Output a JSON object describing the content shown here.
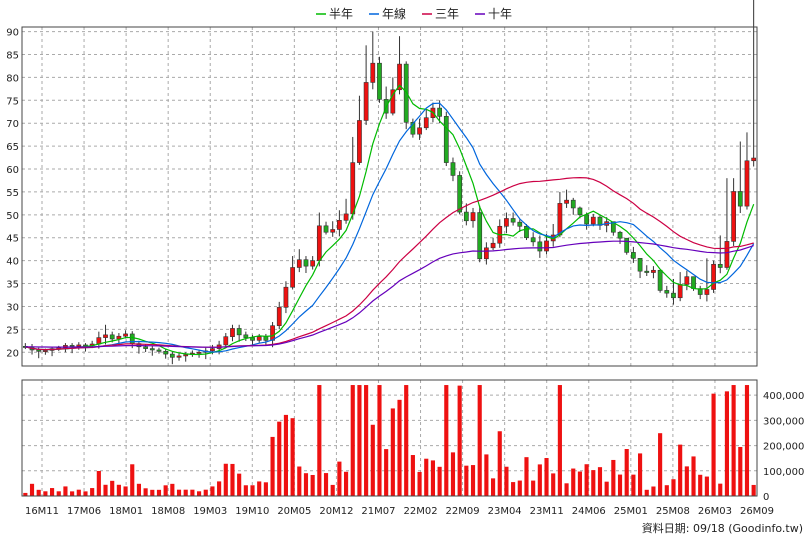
{
  "chart_data": {
    "type": "candlestick",
    "legend": [
      {
        "name": "半年",
        "color": "#00bb00"
      },
      {
        "name": "年線",
        "color": "#0066dd"
      },
      {
        "name": "三年",
        "color": "#cc0044"
      },
      {
        "name": "十年",
        "color": "#6600bb"
      }
    ],
    "price_axis": {
      "ylim": [
        17,
        91
      ],
      "ticks": [
        20,
        25,
        30,
        35,
        40,
        45,
        50,
        55,
        60,
        65,
        70,
        75,
        80,
        85,
        90
      ]
    },
    "volume_axis": {
      "ylim": [
        0,
        460000
      ],
      "ticks": [
        0,
        100000,
        200000,
        300000,
        400000
      ],
      "tick_labels": [
        "0",
        "100,000",
        "200,000",
        "300,000",
        "400,000"
      ]
    },
    "x_labels": [
      "16M11",
      "17M06",
      "18M01",
      "18M08",
      "19M03",
      "19M10",
      "20M05",
      "20M12",
      "21M07",
      "22M02",
      "22M09",
      "23M04",
      "23M11",
      "24M06",
      "25M01",
      "25M08",
      "26M03",
      "26M09"
    ],
    "footer": "資料日期: 09/18  (Goodinfo.tw)",
    "close": [
      21.2,
      20.5,
      20.2,
      20.4,
      20.8,
      21,
      21.5,
      21.3,
      21.6,
      21.4,
      21.8,
      23.2,
      23.8,
      22.9,
      23.5,
      24,
      21.9,
      21.2,
      20.8,
      20.5,
      20.2,
      19.6,
      18.9,
      19.2,
      19.5,
      19.8,
      20,
      20.3,
      20.8,
      21.6,
      23.4,
      25.2,
      23.8,
      23.2,
      22.6,
      23.4,
      22.6,
      25.8,
      29.8,
      34.2,
      38.5,
      40.2,
      38.8,
      40,
      47.6,
      46.2,
      46.8,
      48.8,
      50.2,
      61.4,
      70.6,
      78.9,
      83.1,
      75.2,
      72.2,
      77.3,
      82.9,
      70.2,
      67.6,
      69,
      71.2,
      73.3,
      71.5,
      61.4,
      58.6,
      50.6,
      48.7,
      50.5,
      40.4,
      42.8,
      43.8,
      47.5,
      49.2,
      48.4,
      47.5,
      45,
      44.1,
      42.1,
      44.3,
      45.6,
      52.5,
      53.2,
      51.5,
      50,
      48,
      49.5,
      47.7,
      48.5,
      46.2,
      44.9,
      41.8,
      40.5,
      37.7,
      37.4,
      37.9,
      33.5,
      32.9,
      31.9,
      34.8,
      36.5,
      33.9,
      32.6,
      33.7,
      39.2,
      38.5,
      44.2,
      55.1,
      51.9,
      61.8,
      62.4
    ],
    "open": [
      21.3,
      21.2,
      20.5,
      20.2,
      20.4,
      20.8,
      21,
      21.5,
      21.3,
      21.6,
      21.4,
      21.8,
      23.2,
      23.8,
      22.9,
      23.5,
      24,
      21.9,
      21.2,
      20.8,
      20.5,
      20.2,
      19.6,
      18.9,
      19.2,
      19.5,
      19.8,
      20,
      20.3,
      20.8,
      21.6,
      23.4,
      25.2,
      23.8,
      23.2,
      22.6,
      23.4,
      22.6,
      25.8,
      29.8,
      34.2,
      38.5,
      40.2,
      38.8,
      40,
      47.6,
      46.2,
      46.8,
      48.8,
      50.2,
      61.4,
      70.6,
      78.9,
      83.1,
      75.2,
      72.2,
      77.3,
      82.9,
      70.2,
      67.6,
      69,
      71.2,
      73.3,
      71.5,
      61.4,
      58.6,
      50.6,
      48.7,
      50.5,
      40.4,
      42.8,
      43.8,
      47.5,
      49.2,
      48.4,
      47.5,
      45,
      44.1,
      42.1,
      44.3,
      45.6,
      52.5,
      53.2,
      51.5,
      50,
      48,
      49.5,
      47.7,
      48.5,
      46.2,
      44.9,
      41.8,
      40.5,
      37.7,
      37.4,
      37.9,
      33.5,
      32.9,
      31.9,
      34.8,
      36.5,
      33.9,
      32.6,
      33.7,
      39.2,
      38.5,
      44.2,
      55.1,
      51.9,
      61.8
    ],
    "high": [
      22,
      21.8,
      21,
      20.8,
      21.2,
      21.4,
      22,
      22,
      22.2,
      22,
      22.5,
      24.5,
      26,
      24.5,
      24.2,
      24.8,
      24.6,
      22.5,
      21.8,
      21.4,
      21,
      20.8,
      20.2,
      19.8,
      20,
      20.4,
      20.6,
      21,
      21.6,
      22.5,
      24.2,
      26,
      26,
      24.5,
      23.8,
      24,
      24,
      26.6,
      31,
      35.5,
      41,
      42.5,
      41,
      41,
      50.5,
      48.5,
      48.6,
      51,
      53.5,
      67,
      76,
      87,
      90,
      84.5,
      78,
      80,
      89,
      83.5,
      71,
      71,
      73,
      74.5,
      75,
      72.5,
      62.5,
      59.5,
      52.5,
      51.5,
      52,
      44,
      45,
      49,
      50.5,
      50.5,
      49,
      48,
      46.2,
      45.5,
      45.8,
      48,
      55,
      55.5,
      53.7,
      51.8,
      50.5,
      50.2,
      50,
      49.5,
      48.2,
      46.5,
      44,
      43,
      39.8,
      39,
      38.8,
      35,
      34.5,
      36,
      37.5,
      37.8,
      35.2,
      34.5,
      40.5,
      40,
      45.5,
      58,
      58,
      66,
      68
    ]
  }
}
